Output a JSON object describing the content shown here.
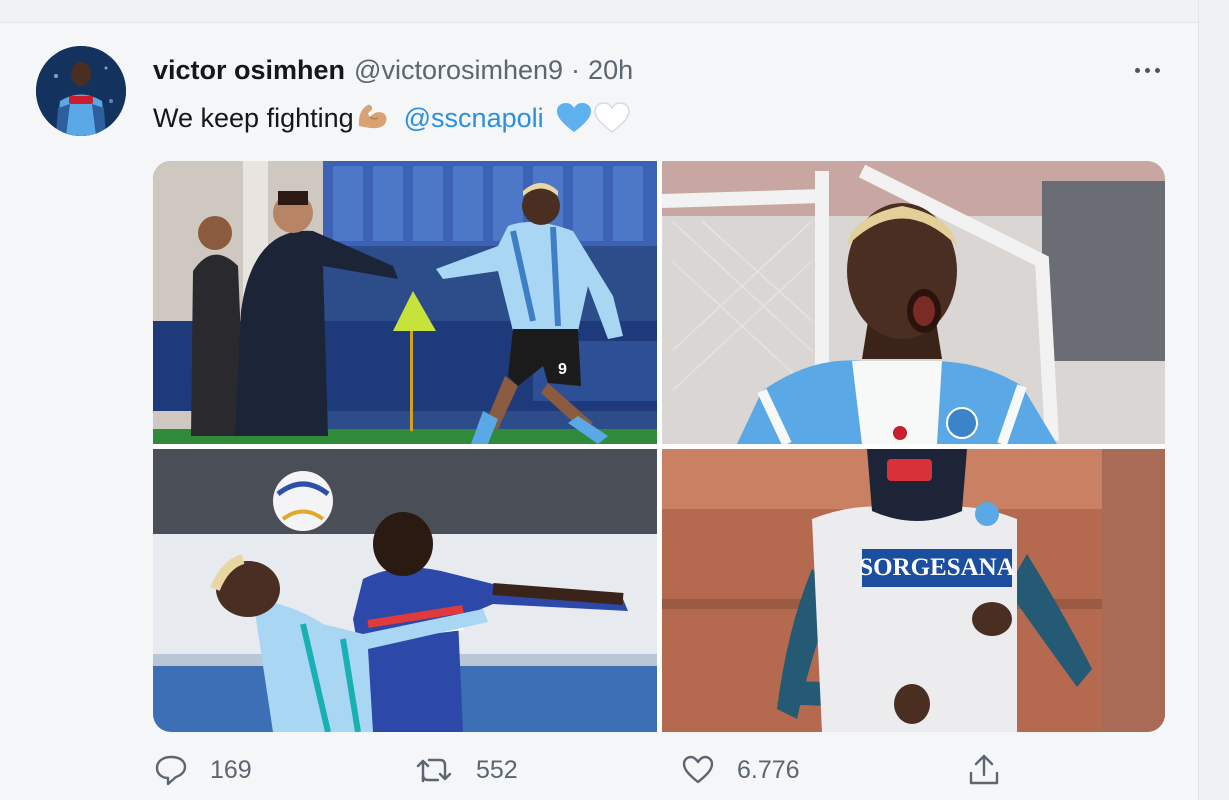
{
  "tweet": {
    "display_name": "victor osimhen",
    "handle": "@victorosimhen9",
    "separator": "·",
    "time": "20h",
    "text": "We keep fighting",
    "emoji_icon": "flexed-biceps-icon",
    "mention": "@sscnapoli",
    "heart_icons": [
      "blue-heart-icon",
      "white-heart-icon"
    ],
    "more_icon": "more-options-icon"
  },
  "media": {
    "photos": [
      {
        "name": "photo-handshake",
        "jersey_number": "9"
      },
      {
        "name": "photo-celebration"
      },
      {
        "name": "photo-header"
      },
      {
        "name": "photo-training",
        "sponsor": "SORGESANA"
      }
    ]
  },
  "actions": {
    "reply_count": "169",
    "retweet_count": "552",
    "like_count": "6.776",
    "icons": [
      "reply-icon",
      "retweet-icon",
      "like-icon",
      "share-icon"
    ]
  },
  "colors": {
    "link": "#2b8fe0",
    "text": "#14171a",
    "muted": "#5b6670",
    "napoli_blue": "#5aa9e6"
  }
}
